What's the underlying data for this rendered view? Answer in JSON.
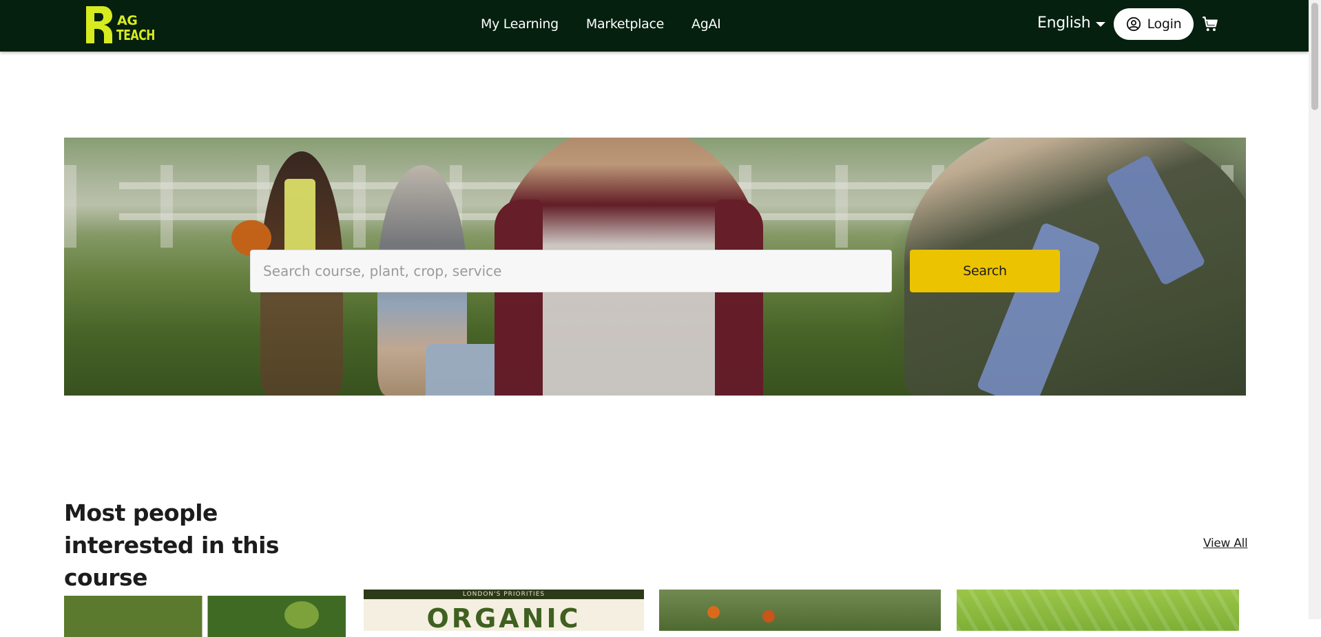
{
  "header": {
    "logo_text_top": "AG",
    "logo_text_bottom": "TEACH",
    "nav": [
      {
        "label": "My Learning"
      },
      {
        "label": "Marketplace"
      },
      {
        "label": "AgAI"
      }
    ],
    "language": "English",
    "login_label": "Login",
    "colors": {
      "bar": "#05200f",
      "logo": "#d6ec1f"
    }
  },
  "hero": {
    "search_placeholder": "Search course, plant, crop, service",
    "search_value": "",
    "search_button": "Search",
    "button_color": "#ecc300"
  },
  "section": {
    "title": "Most people interested in this course",
    "view_all": "View All"
  },
  "cards": [
    {
      "image": "green-beans-garden"
    },
    {
      "image": "organic-poster",
      "small_text": "LONDON'S PRIORITIES",
      "big_text": "ORGANIC"
    },
    {
      "image": "tomato-plants"
    },
    {
      "image": "papaya-leaves"
    }
  ]
}
